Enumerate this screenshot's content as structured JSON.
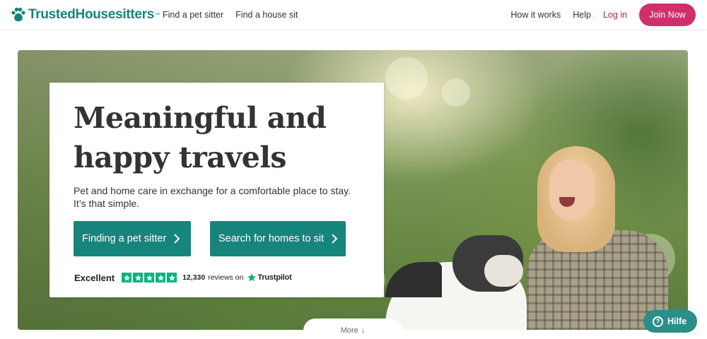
{
  "brand": {
    "name": "TrustedHousesitters",
    "tm": "™",
    "color": "#15847b"
  },
  "nav": {
    "left": [
      "Find a pet sitter",
      "Find a house sit"
    ],
    "how_it_works": "How it works",
    "help": "Help",
    "login": "Log in",
    "join": "Join Now"
  },
  "hero": {
    "title_lines": [
      "Meaningful and",
      "happy travels"
    ],
    "subtitle_lines": [
      "Pet and home care in exchange for a comfortable place to stay.",
      "It’s that simple."
    ],
    "cta_primary": "Finding a pet sitter",
    "cta_secondary": "Search for homes to sit",
    "trustpilot": {
      "rating_label": "Excellent",
      "stars": 5,
      "reviews": "12,330",
      "reviews_suffix": "reviews on",
      "brand": "Trustpilot"
    }
  },
  "more": {
    "label": "More",
    "arrow": "↓"
  },
  "help_widget": {
    "label": "Hilfe",
    "icon": "?"
  },
  "colors": {
    "primary_teal": "#16857b",
    "join_pink": "#d12f6b",
    "login_pink": "#c2185b",
    "trustpilot_green": "#00b67a"
  }
}
